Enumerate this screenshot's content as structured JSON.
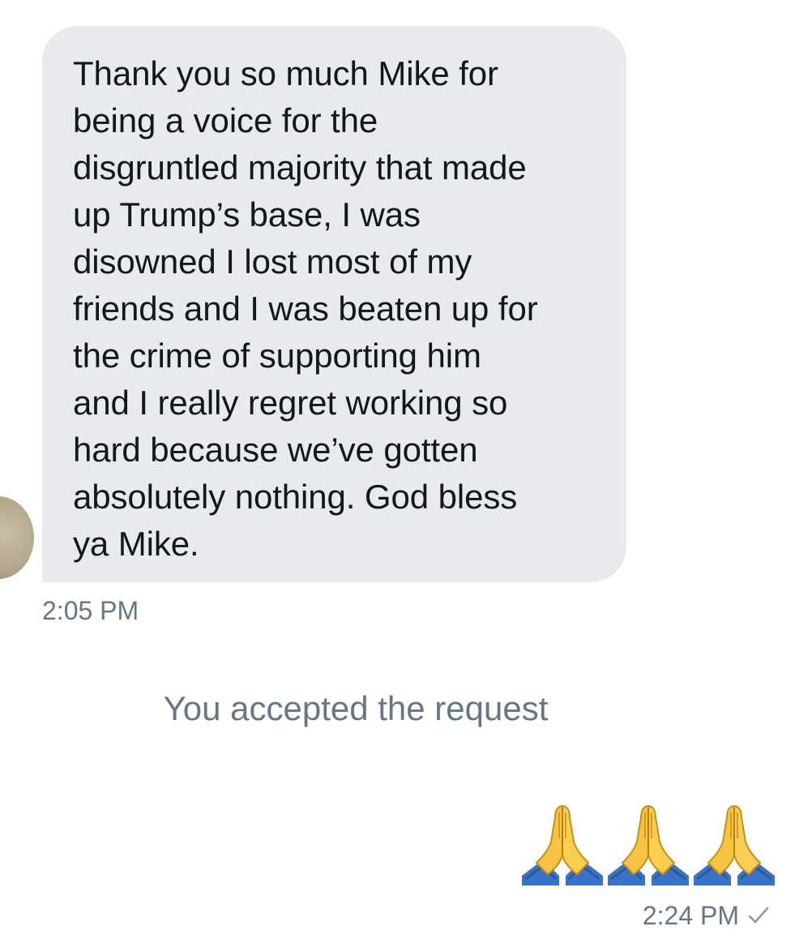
{
  "conversation": {
    "incoming": {
      "text": "Thank you so much Mike for\nbeing a voice for the\ndisgruntled majority that made\nup Trump’s base, I was\ndisowned I lost most of my\nfriends and I was beaten up for\nthe crime of supporting him\nand I really regret working so\nhard because we’ve gotten\nabsolutely nothing. God bless\nya Mike.",
      "time": "2:05 PM",
      "avatar_icon": "user-avatar"
    },
    "system_message": "You accepted the request",
    "outgoing": {
      "emoji": "🙏🙏🙏",
      "emoji_icon": "folded-hands-icon",
      "time": "2:24 PM",
      "status_icon": "checkmark-icon"
    }
  },
  "colors": {
    "bubble_incoming": "#e8eaee",
    "text_primary": "#14171a",
    "text_secondary": "#657786",
    "background": "#ffffff"
  }
}
